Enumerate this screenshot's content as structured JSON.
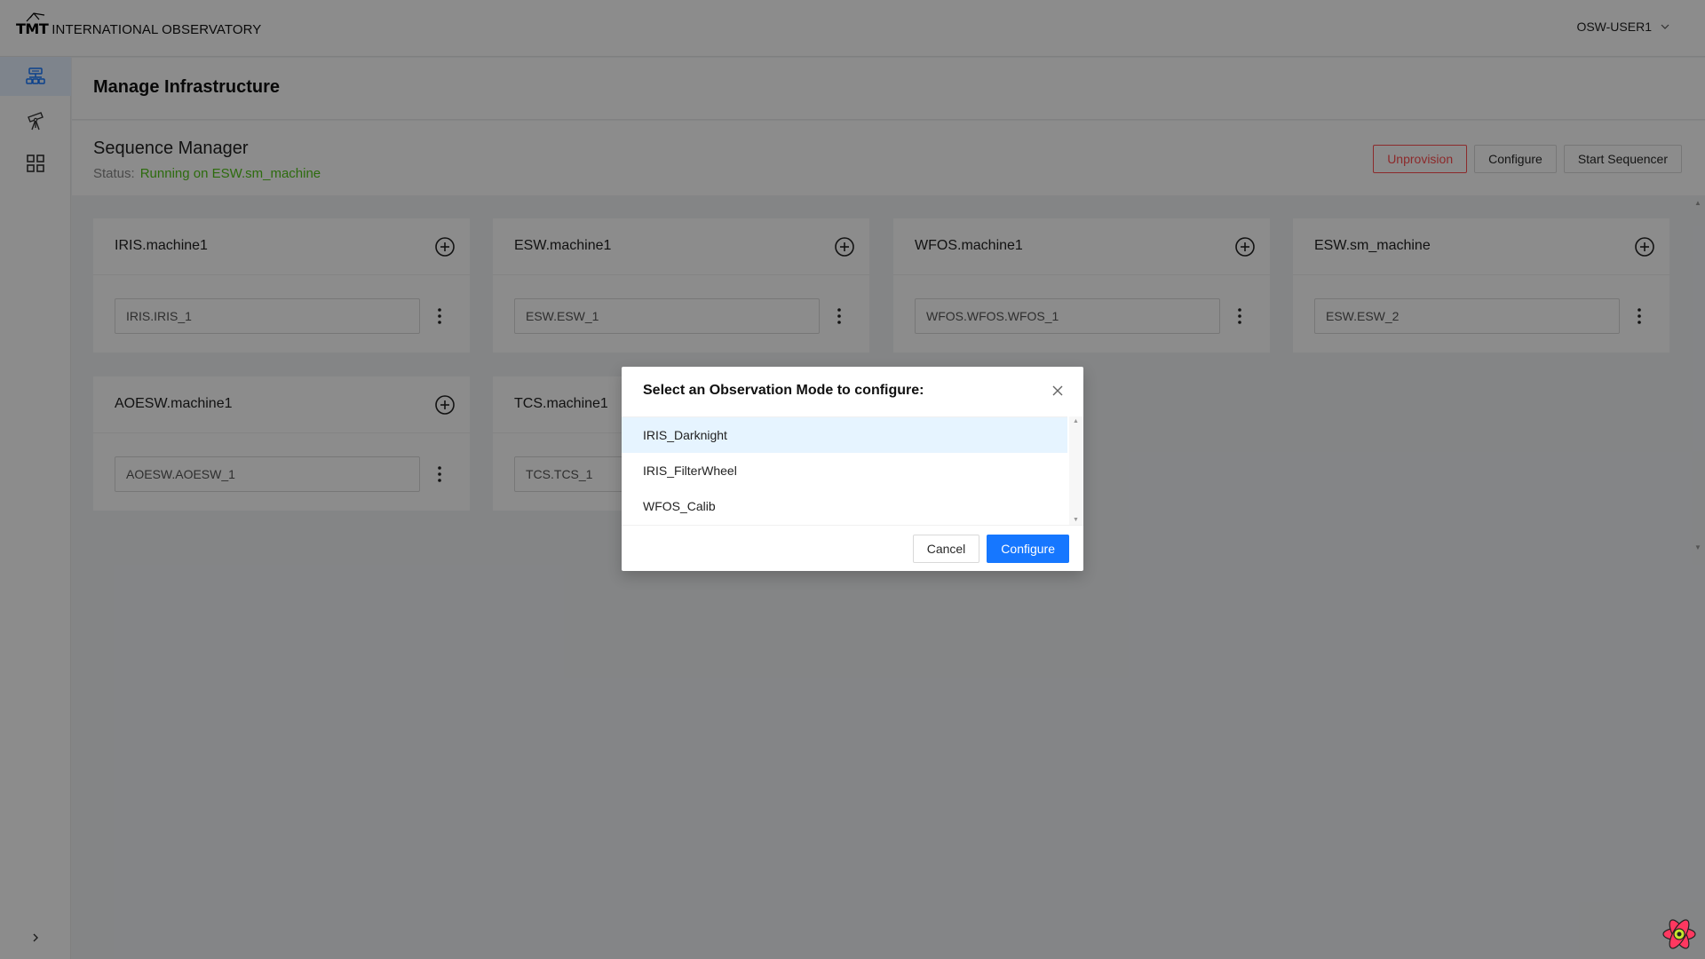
{
  "header": {
    "logo_mark": "TMT",
    "logo_text": "INTERNATIONAL OBSERVATORY",
    "user": "OSW-USER1"
  },
  "sidebar": {
    "items": [
      {
        "icon": "infrastructure-icon",
        "active": true
      },
      {
        "icon": "telescope-icon",
        "active": false
      },
      {
        "icon": "grid-icon",
        "active": false
      }
    ],
    "collapse_icon": "chevron-right-icon"
  },
  "page": {
    "title": "Manage Infrastructure"
  },
  "sequence_manager": {
    "title": "Sequence Manager",
    "status_label": "Status:",
    "status_value": "Running on ESW.sm_machine",
    "actions": {
      "unprovision": "Unprovision",
      "configure": "Configure",
      "start_sequencer": "Start Sequencer"
    }
  },
  "machines": [
    {
      "name": "IRIS.machine1",
      "sequencer": "IRIS.IRIS_1"
    },
    {
      "name": "ESW.machine1",
      "sequencer": "ESW.ESW_1"
    },
    {
      "name": "WFOS.machine1",
      "sequencer": "WFOS.WFOS.WFOS_1"
    },
    {
      "name": "ESW.sm_machine",
      "sequencer": "ESW.ESW_2"
    },
    {
      "name": "AOESW.machine1",
      "sequencer": "AOESW.AOESW_1"
    },
    {
      "name": "TCS.machine1",
      "sequencer": "TCS.TCS_1"
    }
  ],
  "modal": {
    "title": "Select an Observation Mode to configure:",
    "options": [
      "IRIS_Darknight",
      "IRIS_FilterWheel",
      "WFOS_Calib"
    ],
    "selected": "IRIS_Darknight",
    "cancel": "Cancel",
    "configure": "Configure"
  },
  "colors": {
    "primary": "#1677ff",
    "danger": "#ff4d4f",
    "success": "#52c41a",
    "selected_row": "#e6f4ff"
  }
}
